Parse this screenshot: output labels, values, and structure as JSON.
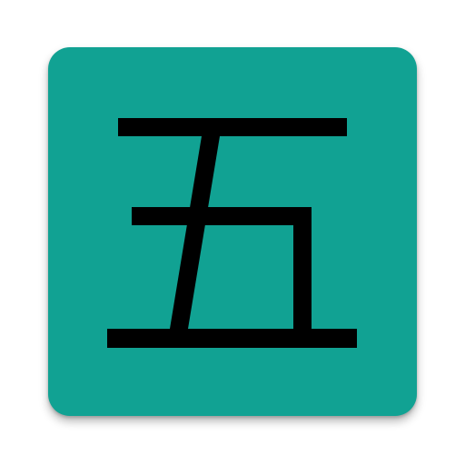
{
  "app_icon": {
    "glyph": "五",
    "background_color": "#11a293",
    "glyph_color": "#000000"
  }
}
